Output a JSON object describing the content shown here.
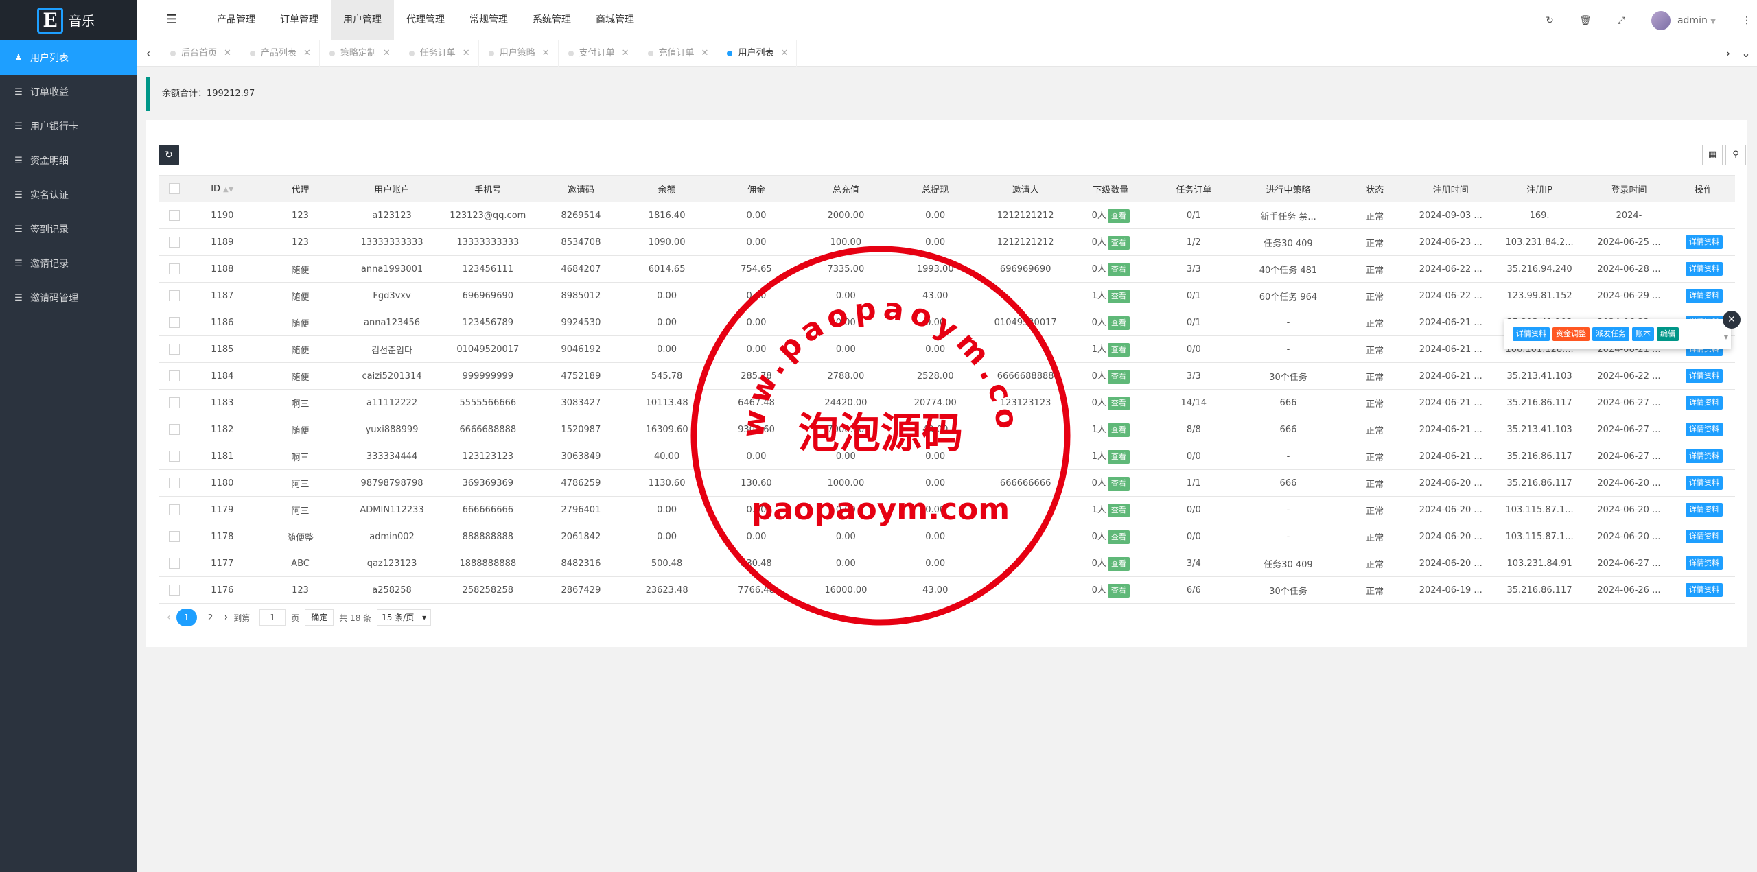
{
  "app": {
    "logo_letter": "E",
    "logo_text": "音乐"
  },
  "sidebar": {
    "items": [
      {
        "label": "用户列表",
        "active": true
      },
      {
        "label": "订单收益"
      },
      {
        "label": "用户银行卡"
      },
      {
        "label": "资金明细"
      },
      {
        "label": "实名认证"
      },
      {
        "label": "签到记录"
      },
      {
        "label": "邀请记录"
      },
      {
        "label": "邀请码管理"
      }
    ]
  },
  "header": {
    "nav": [
      "产品管理",
      "订单管理",
      "用户管理",
      "代理管理",
      "常规管理",
      "系统管理",
      "商城管理"
    ],
    "active_nav": "用户管理",
    "user": "admin"
  },
  "tabs": [
    {
      "label": "后台首页"
    },
    {
      "label": "产品列表"
    },
    {
      "label": "策略定制"
    },
    {
      "label": "任务订单"
    },
    {
      "label": "用户策略"
    },
    {
      "label": "支付订单"
    },
    {
      "label": "充值订单"
    },
    {
      "label": "用户列表",
      "active": true
    }
  ],
  "notice": "余额合计：199212.97",
  "table": {
    "headers": [
      "ID",
      "代理",
      "用户账户",
      "手机号",
      "邀请码",
      "余额",
      "佣金",
      "总充值",
      "总提现",
      "邀请人",
      "下级数量",
      "任务订单",
      "进行中策略",
      "状态",
      "注册时间",
      "注册IP",
      "登录时间",
      "操作"
    ],
    "view_label": "查看",
    "detail_label": "详情资料",
    "rows": [
      [
        "1190",
        "123",
        "a123123",
        "123123@qq.com",
        "8269514",
        "1816.40",
        "0.00",
        "2000.00",
        "0.00",
        "1212121212",
        "0人",
        "0/1",
        "新手任务 禁...",
        "正常",
        "2024-09-03 ...",
        "169.",
        "2024-"
      ],
      [
        "1189",
        "123",
        "13333333333",
        "13333333333",
        "8534708",
        "1090.00",
        "0.00",
        "100.00",
        "0.00",
        "1212121212",
        "0人",
        "1/2",
        "任务30 409",
        "正常",
        "2024-06-23 ...",
        "103.231.84.2...",
        "2024-06-25 ..."
      ],
      [
        "1188",
        "随便",
        "anna1993001",
        "123456111",
        "4684207",
        "6014.65",
        "754.65",
        "7335.00",
        "1993.00",
        "696969690",
        "0人",
        "3/3",
        "40个任务 481",
        "正常",
        "2024-06-22 ...",
        "35.216.94.240",
        "2024-06-28 ..."
      ],
      [
        "1187",
        "随便",
        "Fgd3vxv",
        "696969690",
        "8985012",
        "0.00",
        "0.00",
        "0.00",
        "43.00",
        "",
        "1人",
        "0/1",
        "60个任务 964",
        "正常",
        "2024-06-22 ...",
        "123.99.81.152",
        "2024-06-29 ..."
      ],
      [
        "1186",
        "随便",
        "anna123456",
        "123456789",
        "9924530",
        "0.00",
        "0.00",
        "0.00",
        "0.00",
        "01049520017",
        "0人",
        "0/1",
        "-",
        "正常",
        "2024-06-21 ...",
        "35.213.41.103",
        "2024-06-22 ..."
      ],
      [
        "1185",
        "随便",
        "김선준임다",
        "01049520017",
        "9046192",
        "0.00",
        "0.00",
        "0.00",
        "0.00",
        "",
        "1人",
        "0/0",
        "-",
        "正常",
        "2024-06-21 ...",
        "106.101.128....",
        "2024-06-21 ..."
      ],
      [
        "1184",
        "随便",
        "caizi5201314",
        "999999999",
        "4752189",
        "545.78",
        "285.78",
        "2788.00",
        "2528.00",
        "6666688888",
        "0人",
        "3/3",
        "30个任务",
        "正常",
        "2024-06-21 ...",
        "35.213.41.103",
        "2024-06-22 ..."
      ],
      [
        "1183",
        "啊三",
        "a11112222",
        "5555566666",
        "3083427",
        "10113.48",
        "6467.48",
        "24420.00",
        "20774.00",
        "123123123",
        "0人",
        "14/14",
        "666",
        "正常",
        "2024-06-21 ...",
        "35.216.86.117",
        "2024-06-27 ..."
      ],
      [
        "1182",
        "随便",
        "yuxi888999",
        "6666688888",
        "1520987",
        "16309.60",
        "9309.60",
        "7000.00",
        "40.00",
        "",
        "1人",
        "8/8",
        "666",
        "正常",
        "2024-06-21 ...",
        "35.213.41.103",
        "2024-06-27 ..."
      ],
      [
        "1181",
        "啊三",
        "333334444",
        "123123123",
        "3063849",
        "40.00",
        "0.00",
        "0.00",
        "0.00",
        "",
        "1人",
        "0/0",
        "-",
        "正常",
        "2024-06-21 ...",
        "35.216.86.117",
        "2024-06-27 ..."
      ],
      [
        "1180",
        "阿三",
        "98798798798",
        "369369369",
        "4786259",
        "1130.60",
        "130.60",
        "1000.00",
        "0.00",
        "666666666",
        "0人",
        "1/1",
        "666",
        "正常",
        "2024-06-20 ...",
        "35.216.86.117",
        "2024-06-20 ..."
      ],
      [
        "1179",
        "阿三",
        "ADMIN112233",
        "666666666",
        "2796401",
        "0.00",
        "0.00",
        "0.00",
        "0.00",
        "",
        "1人",
        "0/0",
        "-",
        "正常",
        "2024-06-20 ...",
        "103.115.87.1...",
        "2024-06-20 ..."
      ],
      [
        "1178",
        "随便整",
        "admin002",
        "888888888",
        "2061842",
        "0.00",
        "0.00",
        "0.00",
        "0.00",
        "",
        "0人",
        "0/0",
        "-",
        "正常",
        "2024-06-20 ...",
        "103.115.87.1...",
        "2024-06-20 ..."
      ],
      [
        "1177",
        "ABC",
        "qaz123123",
        "1888888888",
        "8482316",
        "500.48",
        "330.48",
        "0.00",
        "0.00",
        "",
        "0人",
        "3/4",
        "任务30 409",
        "正常",
        "2024-06-20 ...",
        "103.231.84.91",
        "2024-06-27 ..."
      ],
      [
        "1176",
        "123",
        "a258258",
        "258258258",
        "2867429",
        "23623.48",
        "7766.48",
        "16000.00",
        "43.00",
        "",
        "0人",
        "6/6",
        "30个任务",
        "正常",
        "2024-06-19 ...",
        "35.216.86.117",
        "2024-06-26 ..."
      ]
    ]
  },
  "ops_popup": {
    "buttons": [
      {
        "label": "详情资料",
        "color": "#1E9FFF"
      },
      {
        "label": "资金调整",
        "color": "#FF5722"
      },
      {
        "label": "派发任务",
        "color": "#1E9FFF"
      },
      {
        "label": "账本",
        "color": "#1E9FFF"
      },
      {
        "label": "编辑",
        "color": "#009688"
      }
    ]
  },
  "pager": {
    "current": "1",
    "page2": "2",
    "goto_label": "到第",
    "page_input": "1",
    "page_unit": "页",
    "ok": "确定",
    "total": "共 18 条",
    "page_size": "15 条/页"
  },
  "watermark": {
    "top_text": "www.paopaoym.com",
    "center_text": "泡泡源码",
    "bottom_text": "paopaoym.com",
    "color": "#e60012"
  }
}
